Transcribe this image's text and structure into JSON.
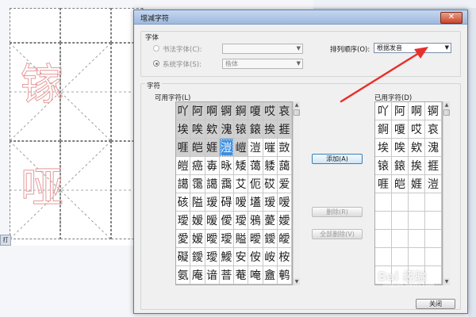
{
  "dialog": {
    "title": "增减字符",
    "close_label": "✕",
    "font_section": "字体",
    "calligraphy_font_label": "书法字体(C):",
    "calligraphy_font_value": "",
    "system_font_label": "系统字体(S):",
    "system_font_value": "楷体",
    "sort_label": "排列顺序(O):",
    "sort_value": "根据发音",
    "chars_section": "字符",
    "available_label": "可用字符(L)",
    "used_label": "已用字符(D)",
    "add_button": "添加(A)",
    "delete_button": "删除(R)",
    "delete_all_button": "全部删除(V)",
    "close_button": "关闭"
  },
  "available_chars": [
    [
      "吖",
      "阿",
      "啊",
      "锕",
      "錒",
      "嗄",
      "哎",
      "哀"
    ],
    [
      "埃",
      "唉",
      "欸",
      "溾",
      "锿",
      "鎄",
      "挨",
      "捱"
    ],
    [
      "啀",
      "皑",
      "娾",
      "溰",
      "嵦",
      "溰",
      "嘊",
      "敳"
    ],
    [
      "皚",
      "癌",
      "毐",
      "昹",
      "矮",
      "蔼",
      "躷",
      "藹"
    ],
    [
      "譪",
      "霭",
      "譪",
      "靄",
      "艾",
      "伌",
      "砹",
      "爱"
    ],
    [
      "硋",
      "隘",
      "瑷",
      "碍",
      "嗳",
      "壒",
      "瑷",
      "嗳"
    ],
    [
      "璦",
      "嫒",
      "暧",
      "僾",
      "璦",
      "鴉",
      "薆",
      "嬡"
    ],
    [
      "愛",
      "嫒",
      "曖",
      "璦",
      "賹",
      "曖",
      "鑀",
      "皧"
    ],
    [
      "礙",
      "鑀",
      "璦",
      "鱫",
      "安",
      "侒",
      "峖",
      "桉"
    ],
    [
      "氨",
      "庵",
      "谙",
      "萻",
      "菴",
      "唵",
      "盦",
      "鹌"
    ]
  ],
  "selected_char": "溰",
  "used_chars": [
    [
      "吖",
      "阿",
      "啊",
      "锕"
    ],
    [
      "錒",
      "嗄",
      "哎",
      "哀"
    ],
    [
      "埃",
      "唉",
      "欸",
      "溾"
    ],
    [
      "锿",
      "鎄",
      "挨",
      "捱"
    ],
    [
      "啀",
      "皑",
      "娾",
      "溰"
    ],
    [
      "",
      "",
      "",
      ""
    ],
    [
      "",
      "",
      "",
      ""
    ],
    [
      "",
      "",
      "",
      ""
    ],
    [
      "",
      "",
      "",
      ""
    ],
    [
      "",
      "",
      "",
      ""
    ]
  ],
  "background": {
    "tab_label": "打",
    "chars": [
      "镓",
      "哑"
    ]
  },
  "watermark": "Bai 经验",
  "watermark_sub": "jingyan.baidu.com",
  "colors": {
    "arrow": "#e8302a",
    "selection": "#3d8fe0",
    "used_cell": "#d0d0d0"
  }
}
